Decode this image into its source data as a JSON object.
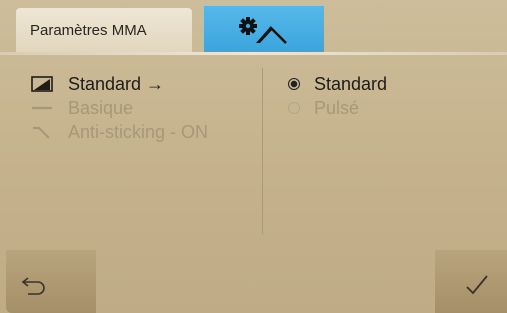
{
  "header": {
    "title": "Paramètres MMA",
    "active_tab_icon": "gear-electrode-icon"
  },
  "menu": {
    "items": [
      {
        "label": "Standard →",
        "icon": "standard-arc-icon",
        "state": "selected"
      },
      {
        "label": "Basique",
        "icon": "flat-line-icon",
        "state": "disabled"
      },
      {
        "label": "Anti-sticking - ON",
        "icon": "anti-sticking-icon",
        "state": "disabled"
      }
    ]
  },
  "radios": {
    "options": [
      {
        "label": "Standard",
        "checked": true
      },
      {
        "label": "Pulsé",
        "checked": false
      }
    ]
  },
  "buttons": {
    "back_icon": "back-arrow-icon",
    "confirm_icon": "checkmark-icon"
  },
  "colors": {
    "accent_tab": "#3aa4dc",
    "background": "#c6b48f",
    "text_active": "#1f1c18",
    "text_disabled": "#a79878"
  }
}
